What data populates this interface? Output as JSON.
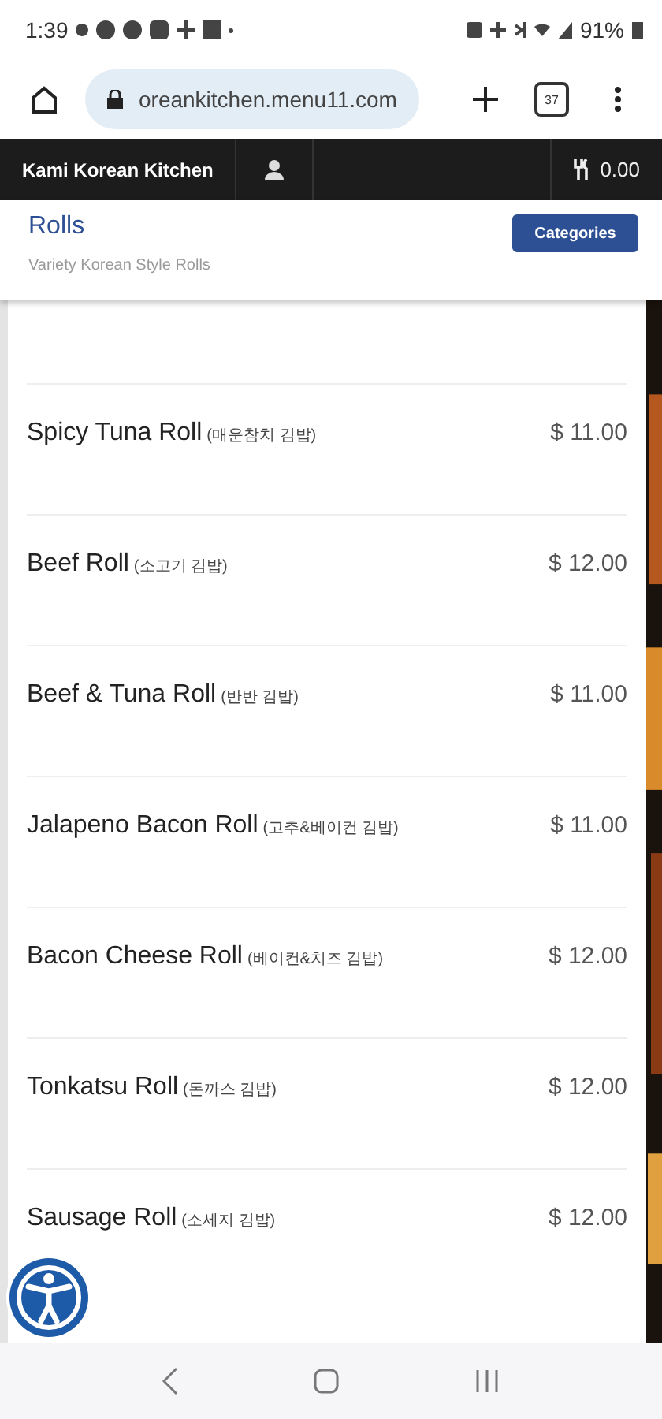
{
  "status_bar": {
    "time": "1:39",
    "battery": "91%"
  },
  "browser": {
    "url": "oreankitchen.menu11.com",
    "tab_count": "37"
  },
  "site_nav": {
    "brand": "Kami Korean Kitchen",
    "cart_total": "0.00"
  },
  "category": {
    "title": "Rolls",
    "subtitle": "Variety Korean Style Rolls",
    "button": "Categories"
  },
  "items": [
    {
      "name": "Spicy Tuna Roll",
      "korean": "(매운참치 김밥)",
      "price": "$ 11.00"
    },
    {
      "name": "Beef Roll",
      "korean": "(소고기 김밥)",
      "price": "$ 12.00"
    },
    {
      "name": "Beef & Tuna Roll",
      "korean": "(반반 김밥)",
      "price": "$ 11.00"
    },
    {
      "name": "Jalapeno Bacon Roll",
      "korean": "(고추&베이컨 김밥)",
      "price": "$ 11.00"
    },
    {
      "name": "Bacon Cheese Roll",
      "korean": "(베이컨&치즈 김밥)",
      "price": "$ 12.00"
    },
    {
      "name": "Tonkatsu Roll",
      "korean": "(돈까스 김밥)",
      "price": "$ 12.00"
    },
    {
      "name": "Sausage Roll",
      "korean": "(소세지 김밥)",
      "price": "$ 12.00"
    }
  ]
}
